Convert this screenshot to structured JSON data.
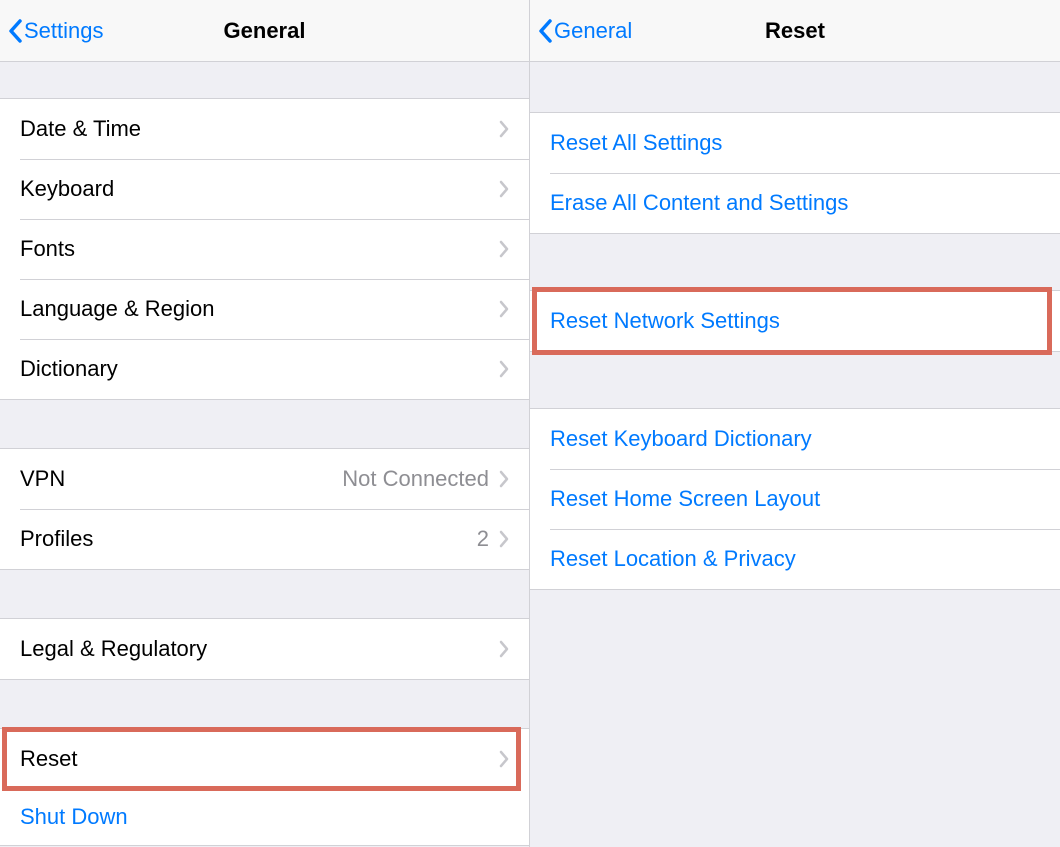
{
  "left": {
    "nav": {
      "back_label": "Settings",
      "title": "General"
    },
    "group1": [
      {
        "label": "Date & Time"
      },
      {
        "label": "Keyboard"
      },
      {
        "label": "Fonts"
      },
      {
        "label": "Language & Region"
      },
      {
        "label": "Dictionary"
      }
    ],
    "group2": [
      {
        "label": "VPN",
        "value": "Not Connected"
      },
      {
        "label": "Profiles",
        "value": "2"
      }
    ],
    "group3": [
      {
        "label": "Legal & Regulatory"
      }
    ],
    "group4": [
      {
        "label": "Reset"
      }
    ],
    "shutdown": "Shut Down"
  },
  "right": {
    "nav": {
      "back_label": "General",
      "title": "Reset"
    },
    "group1": [
      {
        "label": "Reset All Settings"
      },
      {
        "label": "Erase All Content and Settings"
      }
    ],
    "group2": [
      {
        "label": "Reset Network Settings"
      }
    ],
    "group3": [
      {
        "label": "Reset Keyboard Dictionary"
      },
      {
        "label": "Reset Home Screen Layout"
      },
      {
        "label": "Reset Location & Privacy"
      }
    ]
  }
}
